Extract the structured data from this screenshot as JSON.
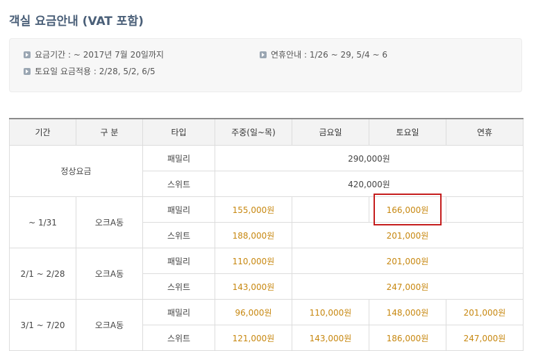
{
  "title": "객실 요금안내 (VAT 포함)",
  "info": {
    "period": "요금기간 : ~ 2017년 7월 20일까지",
    "holiday": "연휴안내 : 1/26 ~ 29, 5/4 ~ 6",
    "saturday": "토요일 요금적용 : 2/28, 5/2, 6/5"
  },
  "table": {
    "headers": [
      "기간",
      "구 분",
      "타입",
      "주중(일~목)",
      "금요일",
      "토요일",
      "연휴"
    ],
    "regular": {
      "label": "정상요금",
      "family_type": "패밀리",
      "family_price": "290,000원",
      "suite_type": "스위트",
      "suite_price": "420,000원"
    },
    "period1": {
      "period": "~ 1/31",
      "category": "오크A동",
      "family_type": "패밀리",
      "family_weekday": "155,000원",
      "family_sat": "166,000원",
      "suite_type": "스위트",
      "suite_weekday": "188,000원",
      "suite_sat": "201,000원"
    },
    "period2": {
      "period": "2/1 ~ 2/28",
      "category": "오크A동",
      "family_type": "패밀리",
      "family_weekday": "110,000원",
      "family_sat": "201,000원",
      "suite_type": "스위트",
      "suite_weekday": "143,000원",
      "suite_sat": "247,000원"
    },
    "period3": {
      "period": "3/1 ~ 7/20",
      "category": "오크A동",
      "family_type": "패밀리",
      "family_weekday": "96,000원",
      "family_fri": "110,000원",
      "family_sat": "148,000원",
      "family_holiday": "201,000원",
      "suite_type": "스위트",
      "suite_weekday": "121,000원",
      "suite_fri": "143,000원",
      "suite_sat": "186,000원",
      "suite_holiday": "247,000원"
    }
  },
  "colors": {
    "title": "#4a5f78",
    "price_orange": "#c7870f",
    "highlight_red": "#c41a1a"
  }
}
